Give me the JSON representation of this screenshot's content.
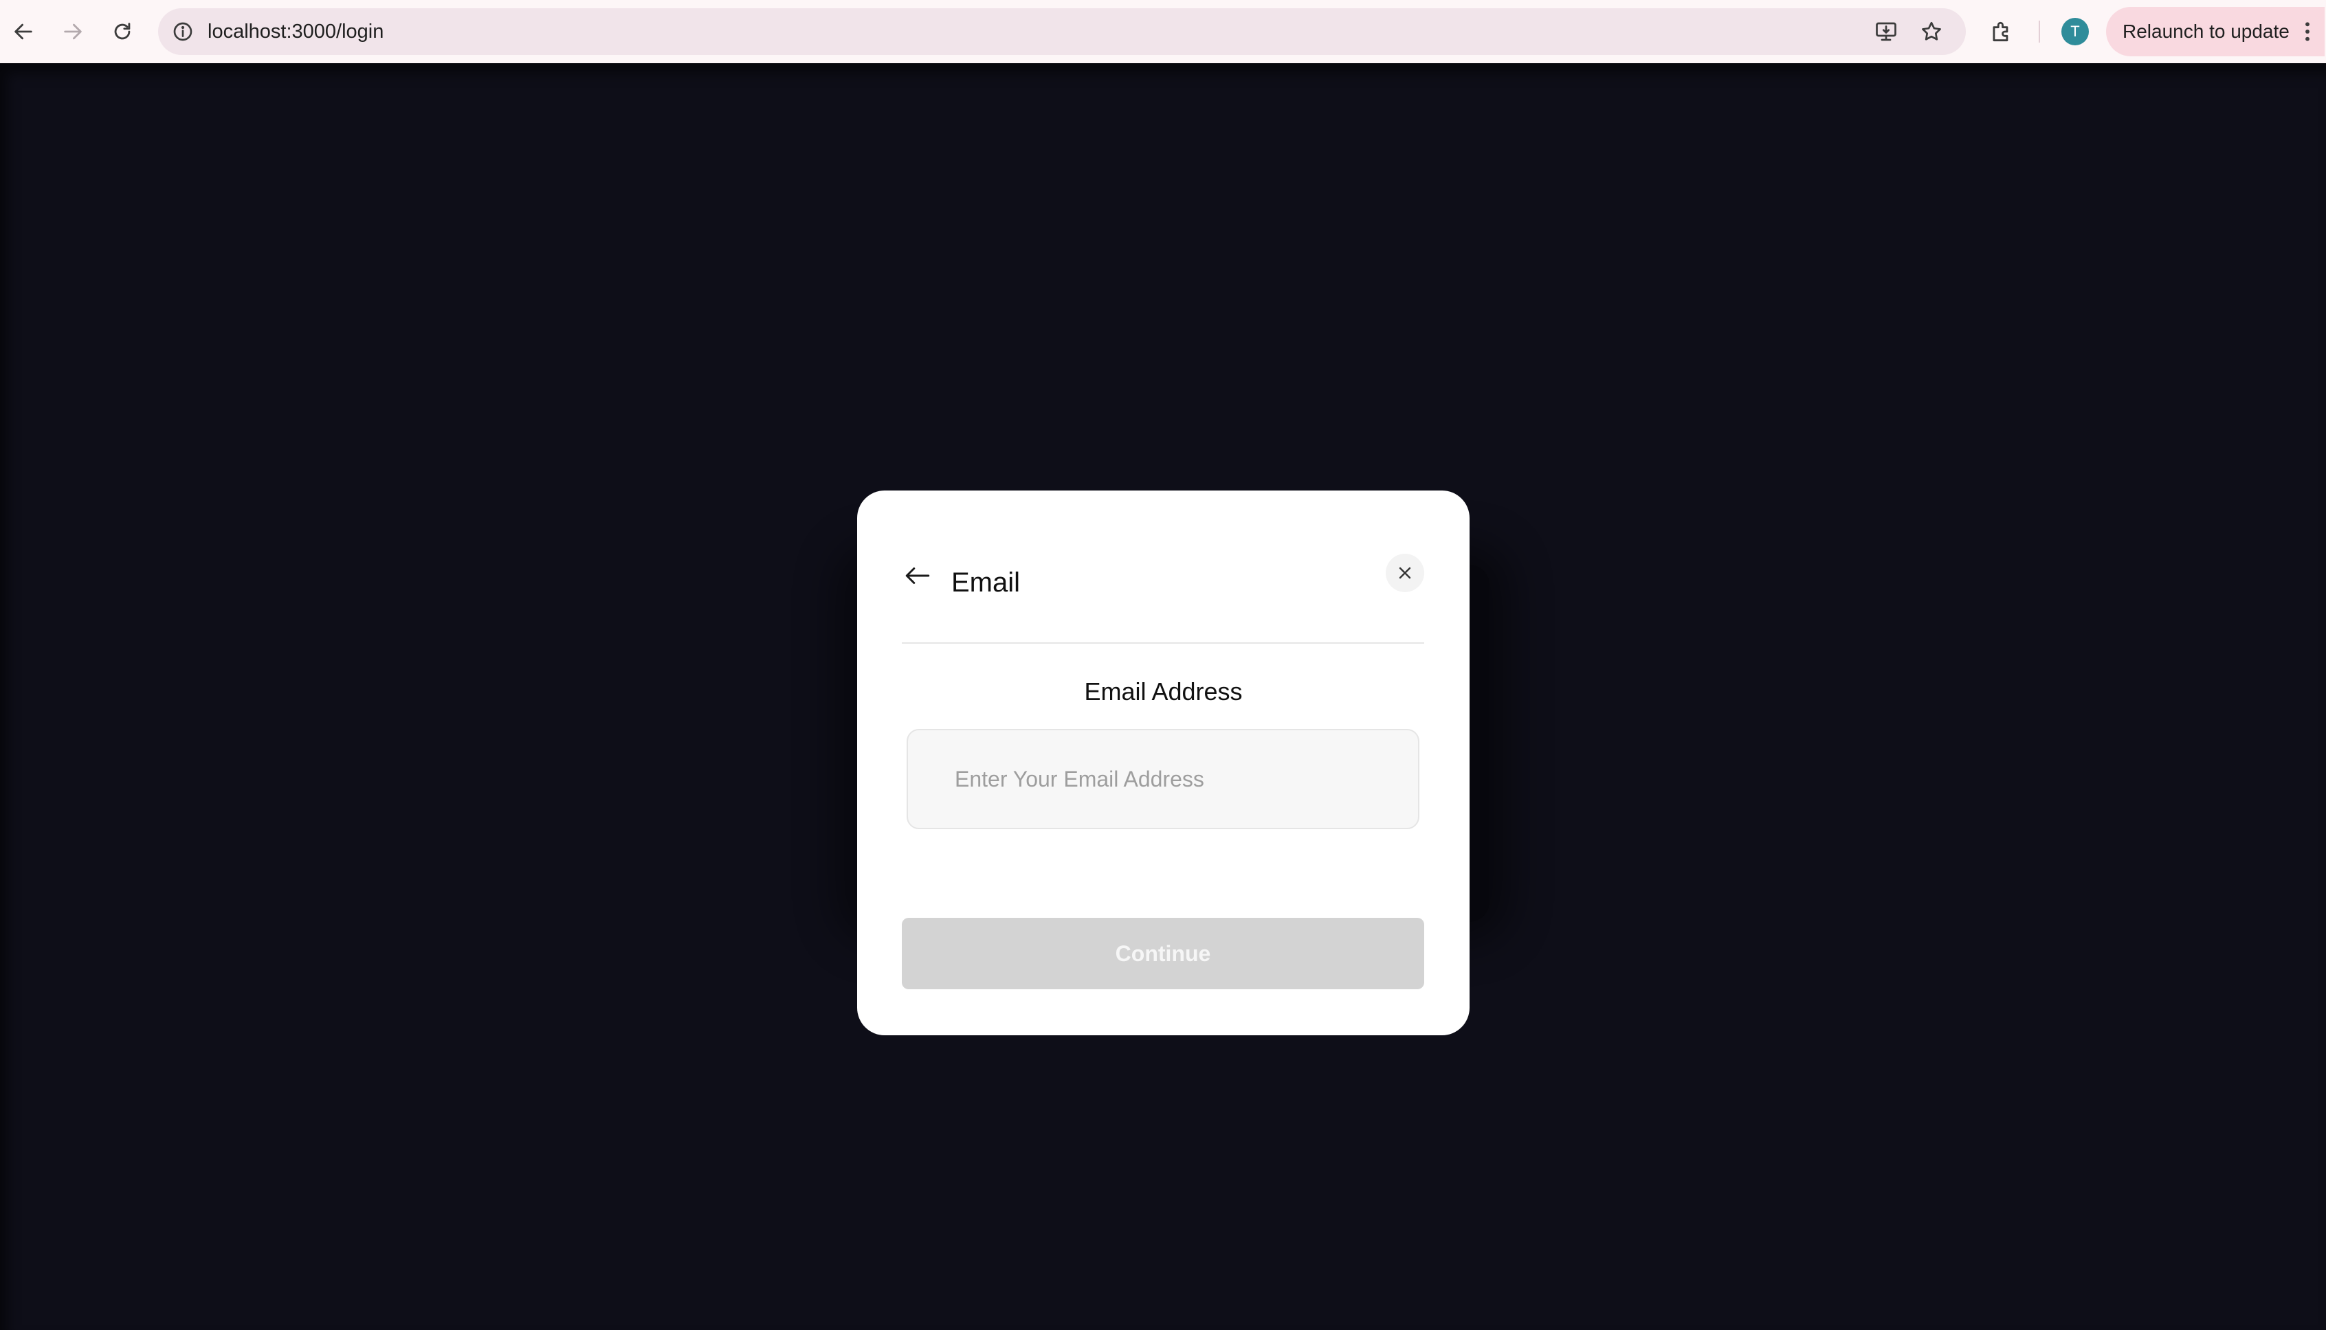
{
  "browser": {
    "url": "localhost:3000/login",
    "profile_initial": "T",
    "relaunch_label": "Relaunch to update",
    "icons": {
      "back": "back-arrow-icon",
      "forward": "forward-arrow-icon",
      "reload": "reload-icon",
      "site_info": "info-icon",
      "install": "install-app-icon",
      "bookmark": "star-icon",
      "extensions": "puzzle-icon",
      "menu": "kebab-menu-icon"
    }
  },
  "modal": {
    "title": "Email",
    "field_label": "Email Address",
    "email_placeholder": "Enter Your Email Address",
    "email_value": "",
    "continue_label": "Continue",
    "continue_disabled": true,
    "icons": {
      "back": "arrow-left-icon",
      "close": "close-icon"
    }
  },
  "colors": {
    "page_background": "#0e0e18",
    "modal_background": "#ffffff",
    "disabled_button": "#d3d3d3",
    "relaunch_chip": "#f9d9e0",
    "avatar": "#2f8c9a"
  }
}
